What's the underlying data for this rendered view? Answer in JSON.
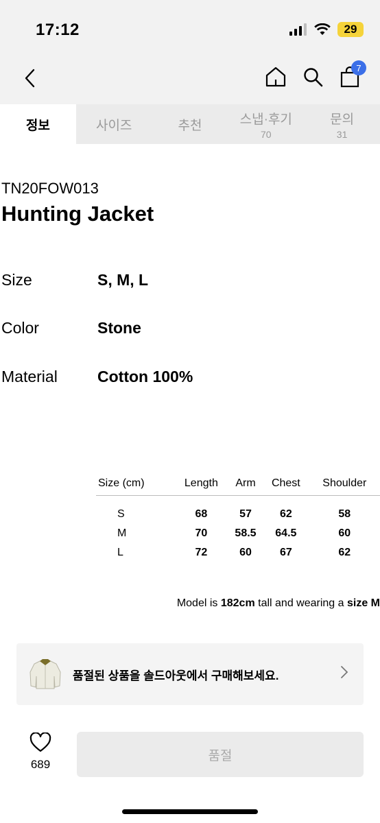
{
  "status": {
    "time": "17:12",
    "battery": "29"
  },
  "nav": {
    "cart_count": "7"
  },
  "tabs": [
    {
      "label": "정보"
    },
    {
      "label": "사이즈"
    },
    {
      "label": "추천"
    },
    {
      "label": "스냅·후기",
      "count": "70"
    },
    {
      "label": "문의",
      "count": "31"
    }
  ],
  "product": {
    "code": "TN20FOW013",
    "name": "Hunting Jacket"
  },
  "specs": [
    {
      "label": "Size",
      "value": "S, M, L"
    },
    {
      "label": "Color",
      "value": "Stone"
    },
    {
      "label": "Material",
      "value": "Cotton 100%"
    }
  ],
  "size_table": {
    "headers": [
      "Size (cm)",
      "Length",
      "Arm",
      "Chest",
      "Shoulder"
    ],
    "rows": [
      [
        "S",
        "68",
        "57",
        "62",
        "58"
      ],
      [
        "M",
        "70",
        "58.5",
        "64.5",
        "60"
      ],
      [
        "L",
        "72",
        "60",
        "67",
        "62"
      ]
    ]
  },
  "model_note": {
    "prefix": "Model is ",
    "height": "182cm",
    "middle": " tall and wearing a ",
    "size": "size M"
  },
  "soldout_banner": {
    "text": "품절된 상품을 솔드아웃에서 구매해보세요."
  },
  "footer": {
    "like_count": "689",
    "buy_label": "품절"
  },
  "colors": {
    "accent": "#3b6fe8",
    "battery": "#f5d33a"
  }
}
